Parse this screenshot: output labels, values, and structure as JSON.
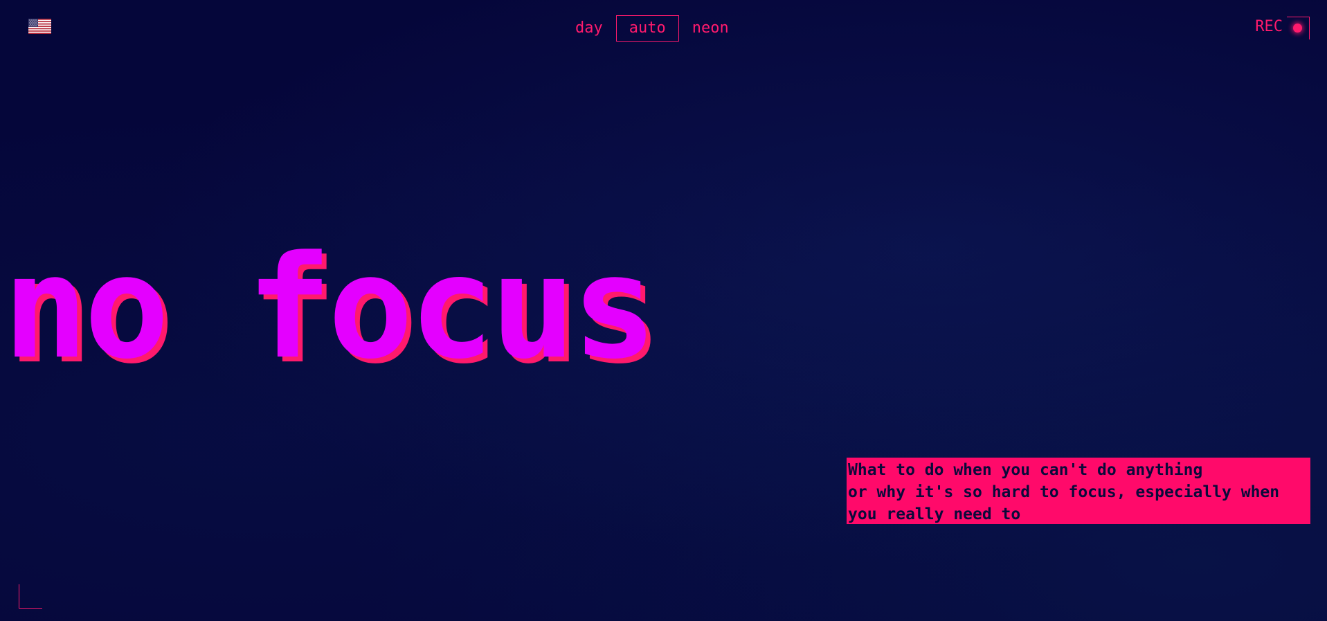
{
  "header": {
    "language_icon": "us-flag-icon",
    "theme_options": [
      {
        "label": "day",
        "active": false
      },
      {
        "label": "auto",
        "active": true
      },
      {
        "label": "neon",
        "active": false
      }
    ],
    "rec_label": "REC"
  },
  "hero": {
    "title": "no focus"
  },
  "subtitle": {
    "lines": [
      "What to do when you can't do anything",
      "or why it's so hard to focus, especially when",
      "you really need to"
    ]
  },
  "colors": {
    "background": "#05063a",
    "accent": "#ff1a6c",
    "title": "#e400ff",
    "subtitle_text": "#0a0a3a"
  }
}
